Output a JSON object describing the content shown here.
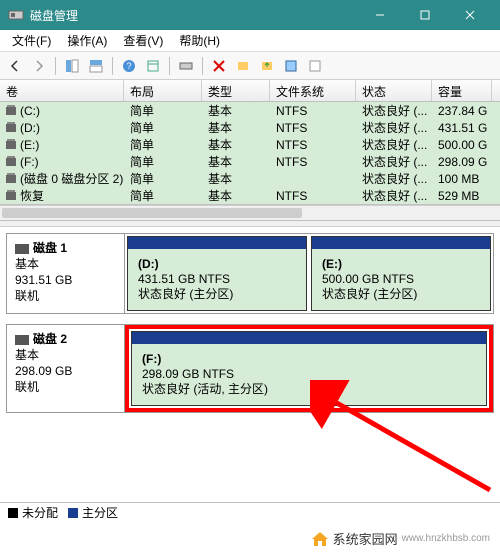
{
  "window": {
    "title": "磁盘管理"
  },
  "menu": {
    "file": "文件(F)",
    "action": "操作(A)",
    "view": "查看(V)",
    "help": "帮助(H)"
  },
  "columns": {
    "volume": "卷",
    "layout": "布局",
    "type": "类型",
    "filesystem": "文件系统",
    "status": "状态",
    "capacity": "容量"
  },
  "volumes": [
    {
      "name": "(C:)",
      "layout": "简单",
      "type": "基本",
      "fs": "NTFS",
      "status": "状态良好 (...",
      "capacity": "237.84 G"
    },
    {
      "name": "(D:)",
      "layout": "简单",
      "type": "基本",
      "fs": "NTFS",
      "status": "状态良好 (...",
      "capacity": "431.51 G"
    },
    {
      "name": "(E:)",
      "layout": "简单",
      "type": "基本",
      "fs": "NTFS",
      "status": "状态良好 (...",
      "capacity": "500.00 G"
    },
    {
      "name": "(F:)",
      "layout": "简单",
      "type": "基本",
      "fs": "NTFS",
      "status": "状态良好 (...",
      "capacity": "298.09 G"
    },
    {
      "name": "(磁盘 0 磁盘分区 2)",
      "layout": "简单",
      "type": "基本",
      "fs": "",
      "status": "状态良好 (...",
      "capacity": "100 MB"
    },
    {
      "name": "恢复",
      "layout": "简单",
      "type": "基本",
      "fs": "NTFS",
      "status": "状态良好 (...",
      "capacity": "529 MB"
    }
  ],
  "disks": [
    {
      "name": "磁盘 1",
      "type": "基本",
      "size": "931.51 GB",
      "state": "联机",
      "partitions": [
        {
          "letter": "(D:)",
          "size": "431.51 GB NTFS",
          "status": "状态良好 (主分区)"
        },
        {
          "letter": "(E:)",
          "size": "500.00 GB NTFS",
          "status": "状态良好 (主分区)"
        }
      ]
    },
    {
      "name": "磁盘 2",
      "type": "基本",
      "size": "298.09 GB",
      "state": "联机",
      "highlight": true,
      "partitions": [
        {
          "letter": "(F:)",
          "size": "298.09 GB NTFS",
          "status": "状态良好 (活动, 主分区)"
        }
      ]
    }
  ],
  "legend": {
    "unallocated": "未分配",
    "primary": "主分区"
  },
  "watermark": {
    "text": "系统家园网",
    "url": "www.hnzkhbsb.com"
  }
}
